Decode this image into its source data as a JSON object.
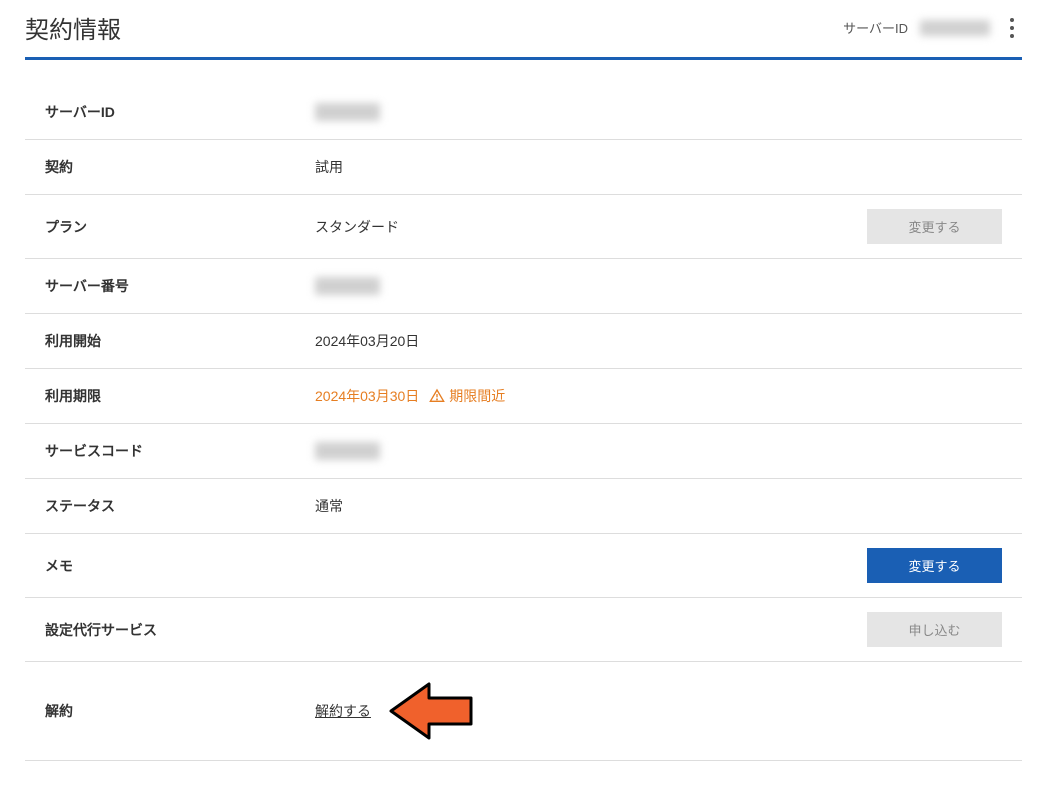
{
  "header": {
    "title": "契約情報",
    "serverIdLabel": "サーバーID"
  },
  "rows": {
    "serverId": {
      "label": "サーバーID"
    },
    "contract": {
      "label": "契約",
      "value": "試用"
    },
    "plan": {
      "label": "プラン",
      "value": "スタンダード",
      "button": "変更する"
    },
    "serverNumber": {
      "label": "サーバー番号"
    },
    "startDate": {
      "label": "利用開始",
      "value": "2024年03月20日"
    },
    "expiry": {
      "label": "利用期限",
      "value": "2024年03月30日",
      "warnLabel": "期限間近"
    },
    "serviceCode": {
      "label": "サービスコード"
    },
    "status": {
      "label": "ステータス",
      "value": "通常"
    },
    "memo": {
      "label": "メモ",
      "button": "変更する"
    },
    "proxyService": {
      "label": "設定代行サービス",
      "button": "申し込む"
    },
    "cancel": {
      "label": "解約",
      "link": "解約する"
    }
  }
}
